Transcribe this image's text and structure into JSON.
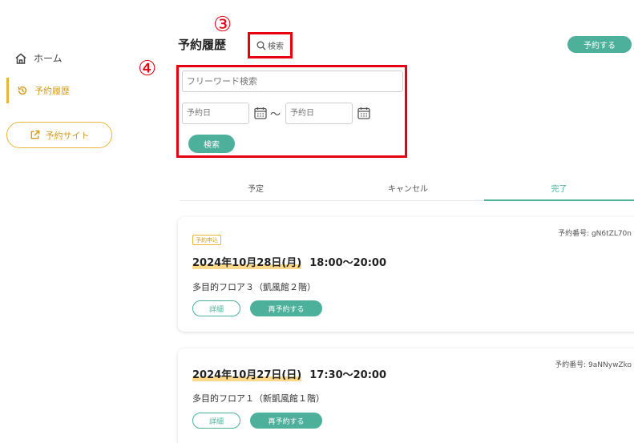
{
  "sidebar": {
    "home_label": "ホーム",
    "history_label": "予約履歴",
    "site_button_label": "予約サイト"
  },
  "header": {
    "title": "予約履歴",
    "search_toggle_label": "検索",
    "reserve_button_label": "予約する"
  },
  "annotations": {
    "marker_3": "③",
    "marker_4": "④"
  },
  "search": {
    "freeword_placeholder": "フリーワード検索",
    "date_from_placeholder": "予約日",
    "date_separator": "～",
    "date_to_placeholder": "予約日",
    "submit_label": "検索"
  },
  "tabs": [
    {
      "label": "予定"
    },
    {
      "label": "キャンセル"
    },
    {
      "label": "完了"
    }
  ],
  "reservations": [
    {
      "reservation_number": "予約番号: gN6tZL70n",
      "badge": "予約申込",
      "date": "2024年10月28日(月)",
      "time": "18:00～20:00",
      "venue": "多目的フロア３（凱風館２階）",
      "detail_label": "詳細",
      "rebook_label": "再予約する"
    },
    {
      "reservation_number": "予約番号: 9aNNywZko",
      "date": "2024年10月27日(日)",
      "time": "17:30～20:00",
      "venue": "多目的フロア１（新凱風館１階）",
      "detail_label": "詳細",
      "rebook_label": "再予約する"
    }
  ],
  "colors": {
    "accent": "#4cb09b",
    "highlight": "#e8b53a",
    "annotation_red": "#e60012"
  }
}
